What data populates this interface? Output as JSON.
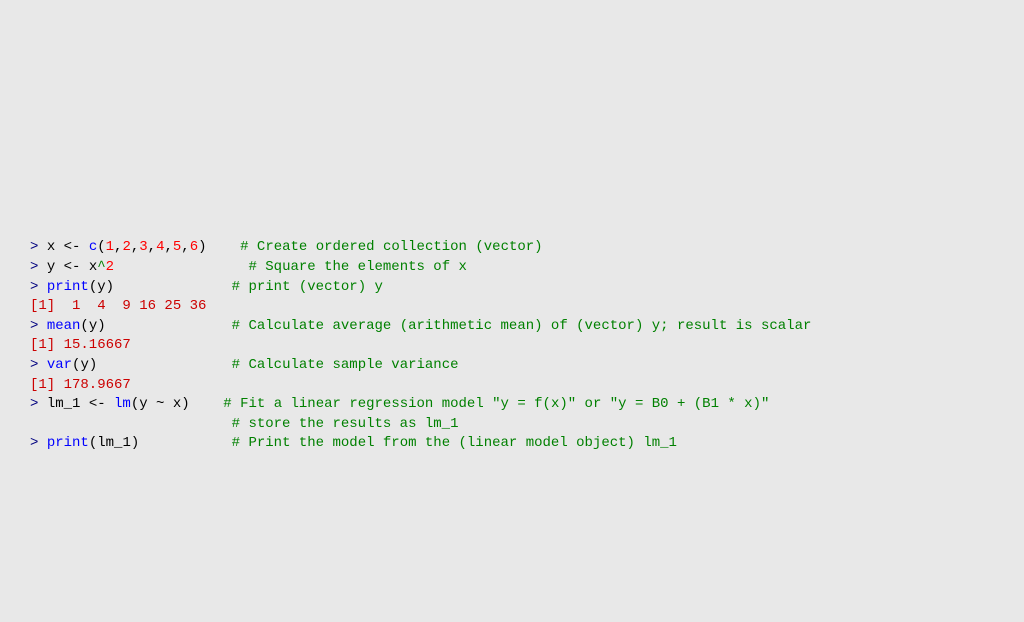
{
  "code": {
    "line1": {
      "prompt": "> ",
      "var_x": "x",
      "assign": " <- ",
      "func_c": "c",
      "paren_open": "(",
      "n1": "1",
      "c1": ",",
      "n2": "2",
      "c2": ",",
      "n3": "3",
      "c3": ",",
      "n4": "4",
      "c4": ",",
      "n5": "5",
      "c5": ",",
      "n6": "6",
      "paren_close": ")",
      "spaces": "    ",
      "comment": "# Create ordered collection (vector)"
    },
    "line2": {
      "prompt": "> ",
      "var_y": "y",
      "assign": " <- ",
      "var_x": "x",
      "caret": "^",
      "n2": "2",
      "spaces": "                ",
      "comment": "# Square the elements of x"
    },
    "line3": {
      "prompt": "> ",
      "func": "print",
      "paren_open": "(",
      "arg": "y",
      "paren_close": ")",
      "spaces": "              ",
      "comment": "# print (vector) y"
    },
    "line4": {
      "output": "[1]  1  4  9 16 25 36"
    },
    "line5": {
      "prompt": "> ",
      "func": "mean",
      "paren_open": "(",
      "arg": "y",
      "paren_close": ")",
      "spaces": "               ",
      "comment": "# Calculate average (arithmetic mean) of (vector) y; result is scalar"
    },
    "line6": {
      "output": "[1] 15.16667"
    },
    "line7": {
      "prompt": "> ",
      "func": "var",
      "paren_open": "(",
      "arg": "y",
      "paren_close": ")",
      "spaces": "                ",
      "comment": "# Calculate sample variance"
    },
    "line8": {
      "output": "[1] 178.9667"
    },
    "line9": {
      "prompt": "> ",
      "var_lm": "lm_1",
      "assign": " <- ",
      "func": "lm",
      "paren_open": "(",
      "arg_y": "y",
      "tilde": " ~ ",
      "arg_x": "x",
      "paren_close": ")",
      "spaces": "    ",
      "comment": "# Fit a linear regression model \"y = f(x)\" or \"y = B0 + (B1 * x)\""
    },
    "line10": {
      "spaces": "                        ",
      "comment": "# store the results as lm_1"
    },
    "line11": {
      "prompt": "> ",
      "func": "print",
      "paren_open": "(",
      "arg": "lm_1",
      "paren_close": ")",
      "spaces": "           ",
      "comment": "# Print the model from the (linear model object) lm_1"
    }
  }
}
